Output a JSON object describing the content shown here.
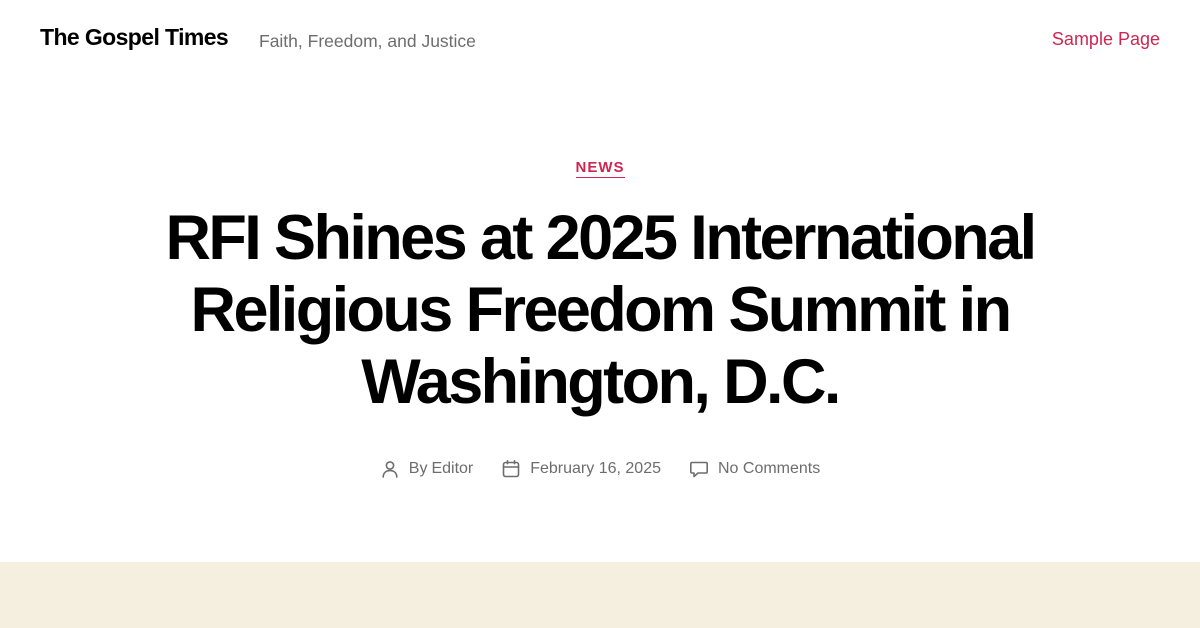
{
  "header": {
    "site_title": "The Gospel Times",
    "site_description": "Faith, Freedom, and Justice",
    "menu": [
      {
        "label": "Sample Page"
      }
    ]
  },
  "post": {
    "category": "NEWS",
    "title": "RFI Shines at 2025 International Religious Freedom Summit in Washington, D.C.",
    "meta": {
      "author_prefix": "By",
      "author": "Editor",
      "date": "February 16, 2025",
      "comments": "No Comments"
    }
  },
  "icons": {
    "author": "user-icon",
    "date": "calendar-icon",
    "comments": "comment-bubble-icon"
  },
  "colors": {
    "accent": "#cd2653",
    "text": "#000000",
    "secondary_text": "#6d6d6d",
    "cover_background": "#f5efe0"
  }
}
